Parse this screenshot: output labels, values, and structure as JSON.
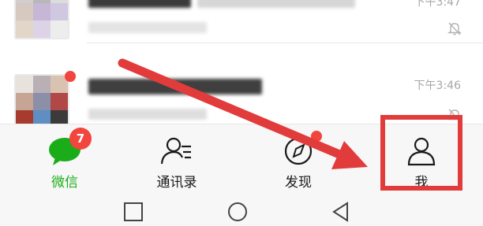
{
  "chat_list": {
    "rows": [
      {
        "time": "下午3:47",
        "muted": true,
        "unread_dot": false
      },
      {
        "time": "下午3:46",
        "muted": true,
        "unread_dot": true
      }
    ]
  },
  "tab_bar": {
    "tabs": [
      {
        "label": "微信",
        "icon": "chat-bubble-icon",
        "badge": "7",
        "active": true
      },
      {
        "label": "通讯录",
        "icon": "contacts-icon",
        "active": false
      },
      {
        "label": "发现",
        "icon": "compass-icon",
        "dot": true,
        "active": false
      },
      {
        "label": "我",
        "icon": "person-icon",
        "active": false
      }
    ]
  },
  "annotation": {
    "color": "#e23b3b"
  },
  "colors": {
    "accent_green": "#1aad19",
    "badge_red": "#f2453d"
  },
  "nav_bar": {
    "buttons": [
      "recent-apps-icon",
      "home-icon",
      "back-icon"
    ]
  }
}
